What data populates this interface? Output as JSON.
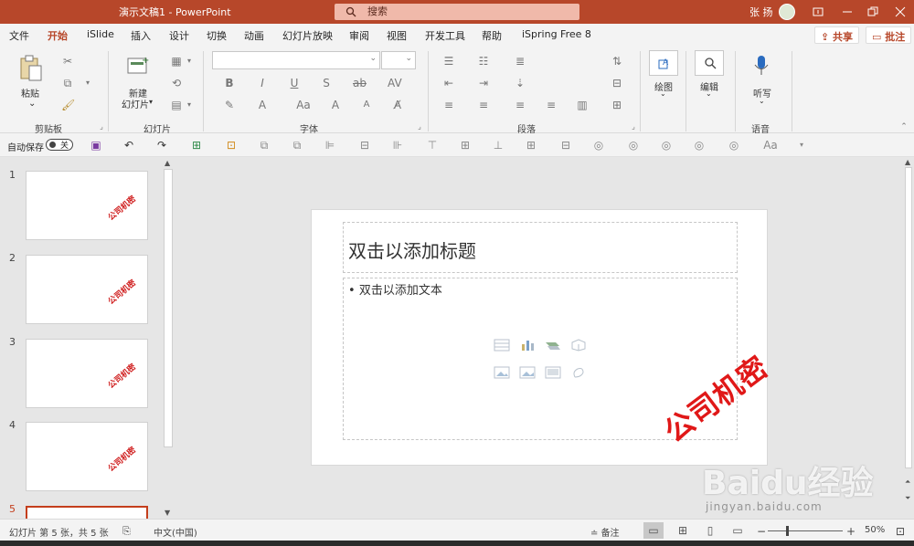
{
  "titlebar": {
    "title": "演示文稿1  -  PowerPoint",
    "search_placeholder": "搜索",
    "user": "张 扬"
  },
  "tabs": [
    "文件",
    "开始",
    "iSlide",
    "插入",
    "设计",
    "切换",
    "动画",
    "幻灯片放映",
    "审阅",
    "视图",
    "开发工具",
    "帮助",
    "iSpring Free 8"
  ],
  "active_tab": "开始",
  "share_label": "共享",
  "comment_label": "批注",
  "ribbon": {
    "paste_label": "粘贴",
    "clipboard_group": "剪贴板",
    "new_slide_label": "新建\n幻灯片",
    "new_slide_line1": "新建",
    "new_slide_line2": "幻灯片",
    "slides_group": "幻灯片",
    "font_group": "字体",
    "paragraph_group": "段落",
    "draw_label": "绘图",
    "edit_label": "编辑",
    "dictate_label": "听写",
    "voice_group": "语音"
  },
  "qat": {
    "autosave_label": "自动保存",
    "autosave_state": "关"
  },
  "slides": [
    {
      "number": "1",
      "watermark": "公司机密"
    },
    {
      "number": "2",
      "watermark": "公司机密"
    },
    {
      "number": "3",
      "watermark": "公司机密"
    },
    {
      "number": "4",
      "watermark": "公司机密"
    },
    {
      "number": "5",
      "watermark": ""
    }
  ],
  "current_slide": {
    "title_placeholder": "双击以添加标题",
    "body_placeholder": "双击以添加文本",
    "watermark": "公司机密"
  },
  "overlay": {
    "brand": "Baidu经验",
    "url": "jingyan.baidu.com"
  },
  "status": {
    "slide_info": "幻灯片 第 5 张，共 5 张",
    "language": "中文(中国)",
    "notes_label": "备注",
    "zoom": "50%"
  },
  "colors": {
    "accent": "#b7472a",
    "watermark_red": "#e01818"
  }
}
